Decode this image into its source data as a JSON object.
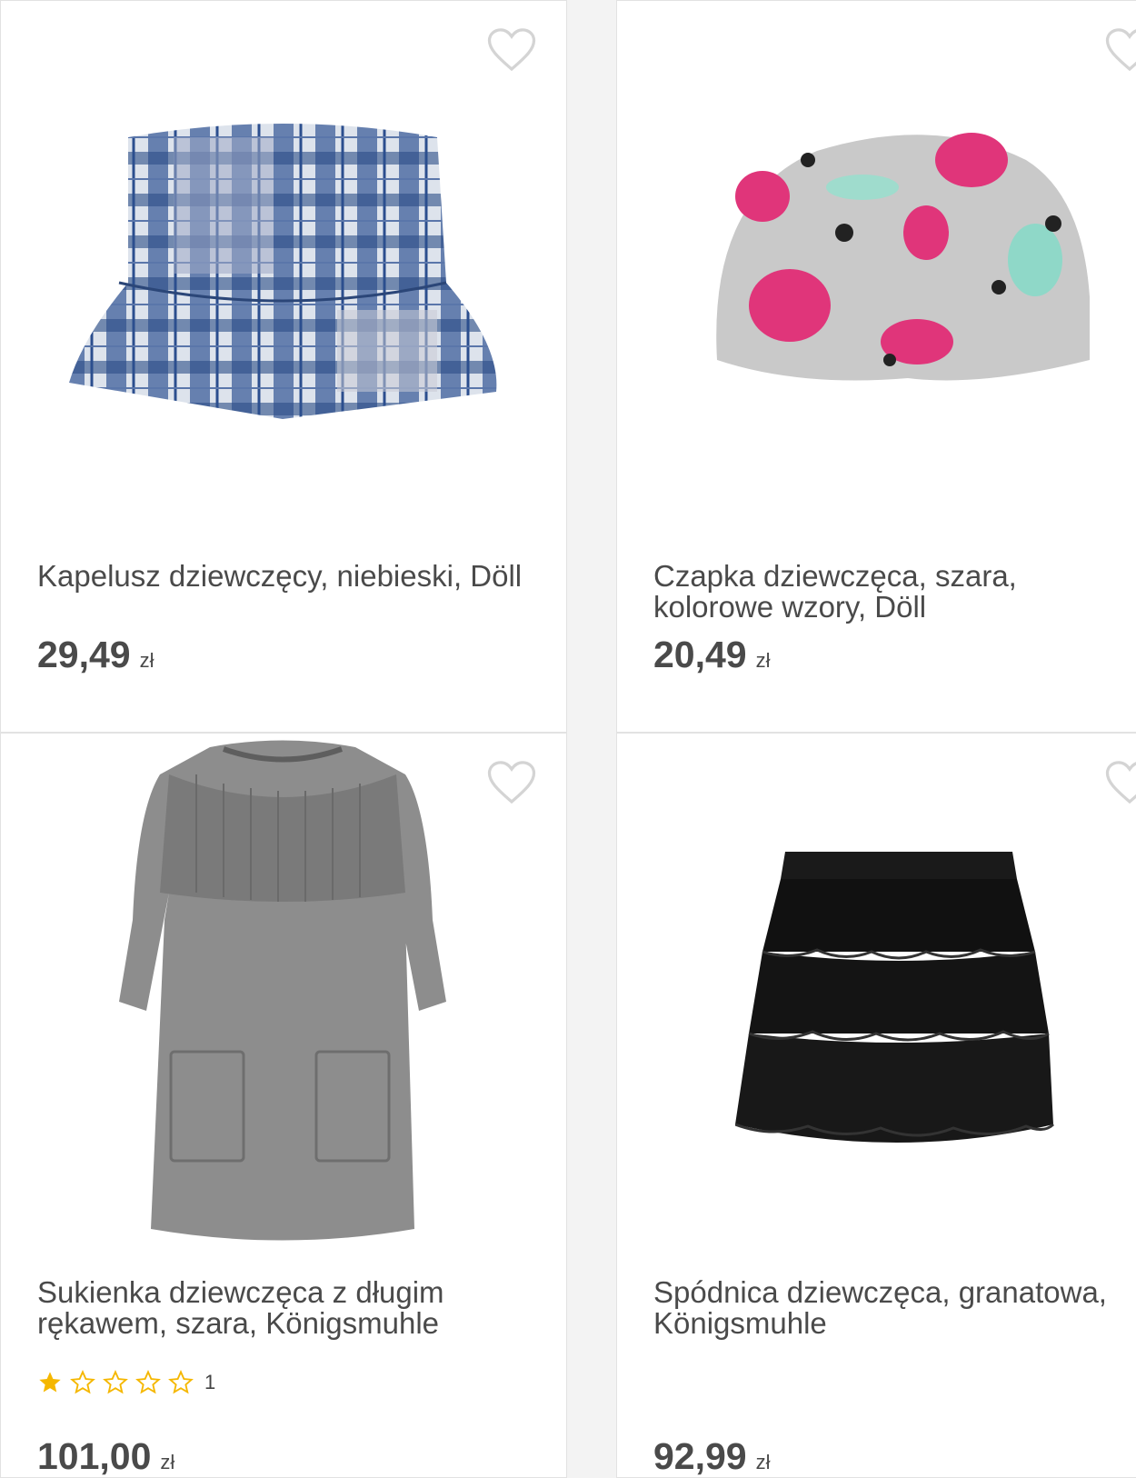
{
  "products": [
    {
      "title": "Kapelusz dziewczęcy, niebieski, Döll",
      "price": "29,49",
      "currency": "zł",
      "image_icon": "bucket-hat-image"
    },
    {
      "title": "Czapka dziewczęca, szara, kolorowe wzory, Döll",
      "price": "20,49",
      "currency": "zł",
      "image_icon": "beanie-image"
    },
    {
      "title": "Sukienka dziewczęca z długim rękawem, szara, Königsmuhle",
      "price": "101,00",
      "currency": "zł",
      "rating": {
        "value": 1,
        "max": 5,
        "count": "1"
      },
      "image_icon": "dress-image"
    },
    {
      "title": "Spódnica dziewczęca, granatowa, Königsmuhle",
      "price": "92,99",
      "currency": "zł",
      "image_icon": "skirt-image"
    }
  ],
  "colors": {
    "text": "#4a4a4a",
    "star": "#f5b700",
    "heart": "#d4d4d4"
  }
}
